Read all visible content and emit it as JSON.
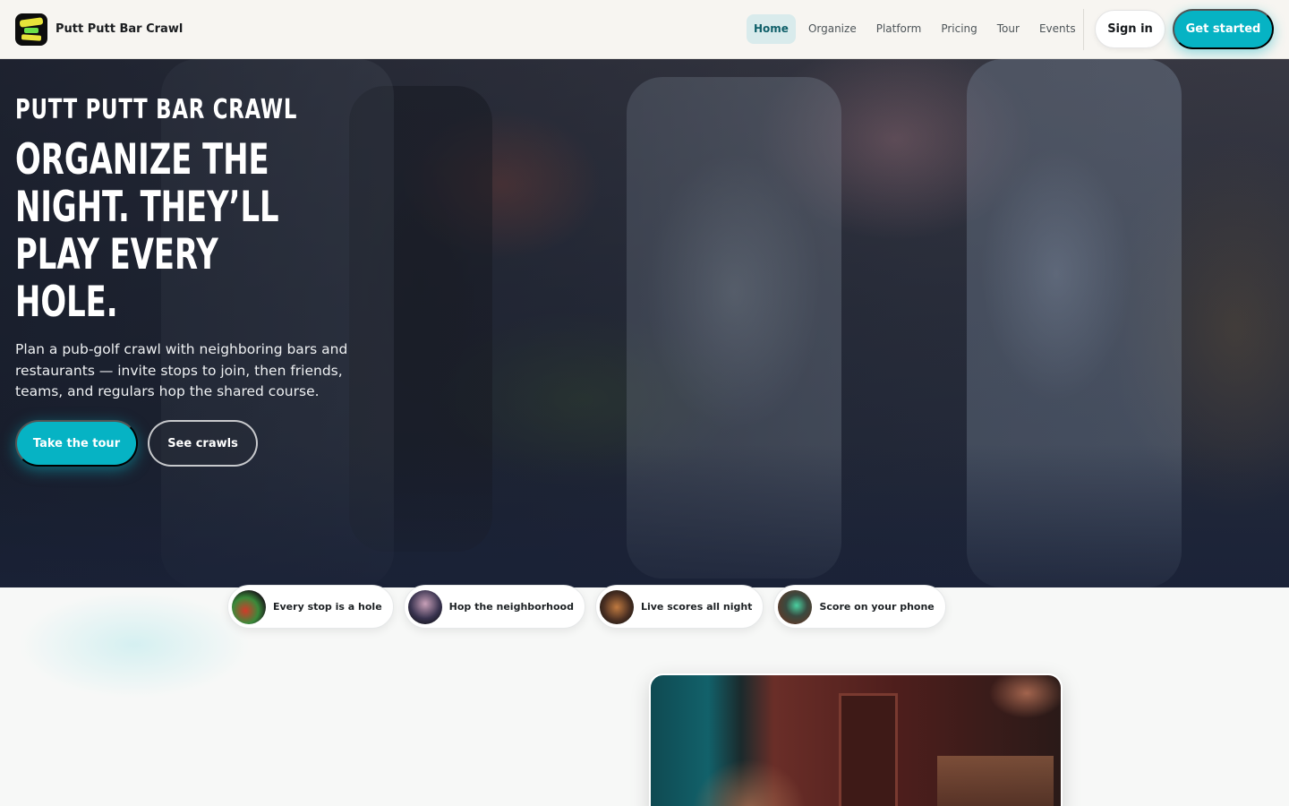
{
  "brand": {
    "name": "Putt Putt Bar Crawl",
    "logo_icon": "logo-icon"
  },
  "nav": {
    "links": [
      "Home",
      "Organize",
      "Platform",
      "Pricing",
      "Tour",
      "Events"
    ],
    "active": "Home",
    "sign_in": "Sign in",
    "get_started": "Get started"
  },
  "hero": {
    "eyebrow": "PUTT PUTT BAR CRAWL",
    "headline": "ORGANIZE THE NIGHT. THEY’LL PLAY EVERY HOLE.",
    "subtext": "Plan a pub-golf crawl with neighboring bars and restaurants — invite stops to join, then friends, teams, and regulars hop the shared course.",
    "primary_cta": "Take the tour",
    "secondary_cta": "See crawls"
  },
  "features": [
    {
      "label": "Every stop is a hole"
    },
    {
      "label": "Hop the neighborhood"
    },
    {
      "label": "Live scores all night"
    },
    {
      "label": "Score on your phone"
    }
  ],
  "colors": {
    "accent": "#06b3c4",
    "hero_overlay": "#1f2638",
    "nav_bg": "#f7f5f1",
    "page_bg": "#f7f8f7"
  }
}
